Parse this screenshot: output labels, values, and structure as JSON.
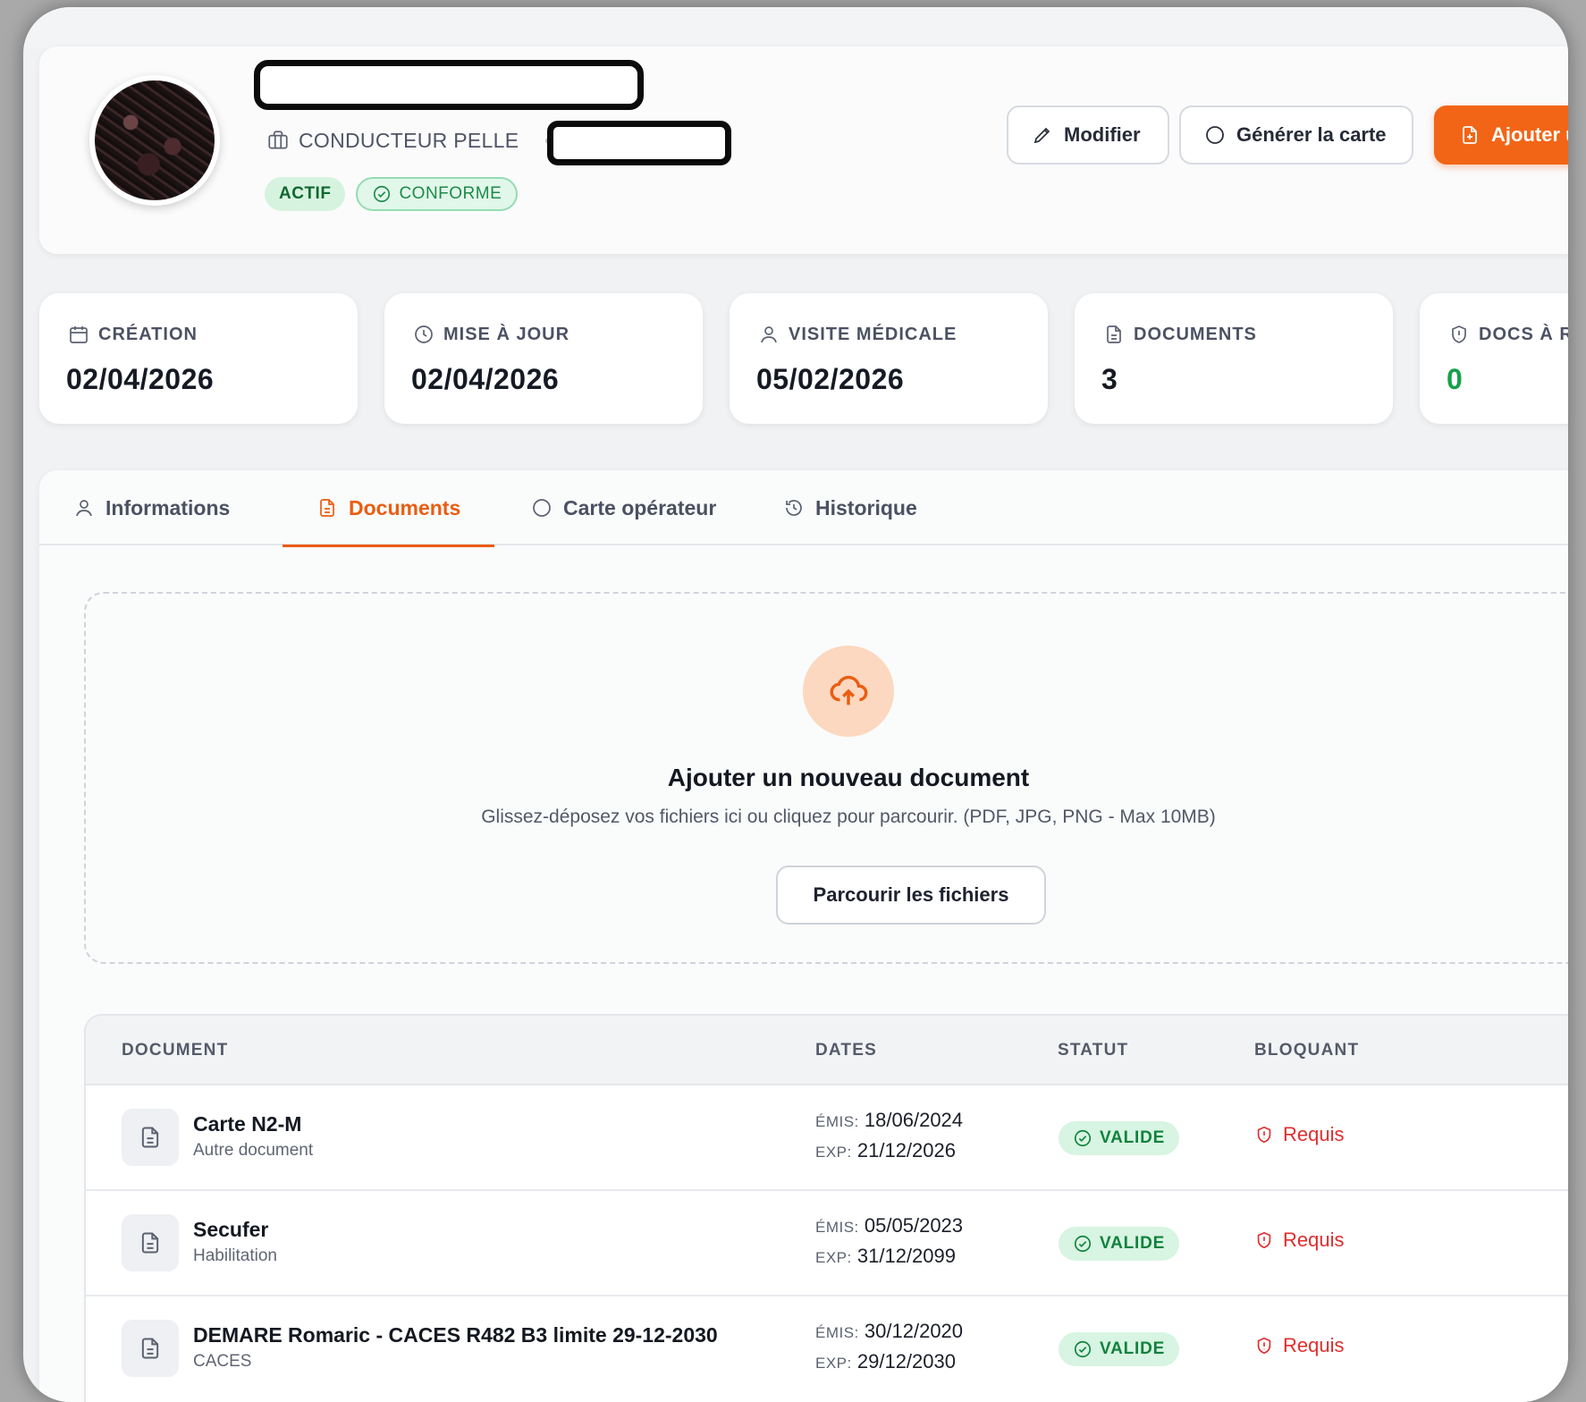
{
  "header": {
    "role": "CONDUCTEUR PELLE",
    "badges": {
      "actif": "ACTIF",
      "conforme": "CONFORME"
    },
    "buttons": {
      "modifier": "Modifier",
      "generer": "Générer la carte",
      "ajouter": "Ajouter un"
    }
  },
  "stats": [
    {
      "label": "CRÉATION",
      "value": "02/04/2026",
      "icon": "calendar-icon"
    },
    {
      "label": "MISE À JOUR",
      "value": "02/04/2026",
      "icon": "clock-icon"
    },
    {
      "label": "VISITE MÉDICALE",
      "value": "05/02/2026",
      "icon": "user-icon"
    },
    {
      "label": "DOCUMENTS",
      "value": "3",
      "icon": "document-icon"
    },
    {
      "label": "DOCS À R",
      "value": "0",
      "icon": "shield-icon",
      "value_color": "#17a04b"
    }
  ],
  "tabs": [
    {
      "label": "Informations",
      "icon": "user-icon"
    },
    {
      "label": "Documents",
      "icon": "document-icon",
      "active": true
    },
    {
      "label": "Carte opérateur",
      "icon": "circle-icon"
    },
    {
      "label": "Historique",
      "icon": "history-icon"
    }
  ],
  "dropzone": {
    "title": "Ajouter un nouveau document",
    "subtitle": "Glissez-déposez vos fichiers ici ou cliquez pour parcourir. (PDF, JPG, PNG - Max 10MB)",
    "browse_label": "Parcourir les fichiers"
  },
  "table": {
    "headers": {
      "document": "DOCUMENT",
      "dates": "DATES",
      "statut": "STATUT",
      "bloquant": "BLOQUANT"
    },
    "emis_label": "ÉMIS:",
    "exp_label": "EXP:",
    "rows": [
      {
        "name": "Carte N2-M",
        "type": "Autre document",
        "emis": "18/06/2024",
        "exp": "21/12/2026",
        "status": "VALIDE",
        "bloquant": "Requis"
      },
      {
        "name": "Secufer",
        "type": "Habilitation",
        "emis": "05/05/2023",
        "exp": "31/12/2099",
        "status": "VALIDE",
        "bloquant": "Requis"
      },
      {
        "name": "DEMARE Romaric - CACES R482 B3 limite 29-12-2030",
        "type": "CACES",
        "emis": "30/12/2020",
        "exp": "29/12/2030",
        "status": "VALIDE",
        "bloquant": "Requis"
      }
    ]
  },
  "colors": {
    "accent": "#f26516",
    "success": "#17a04b",
    "danger": "#e02d2d"
  }
}
